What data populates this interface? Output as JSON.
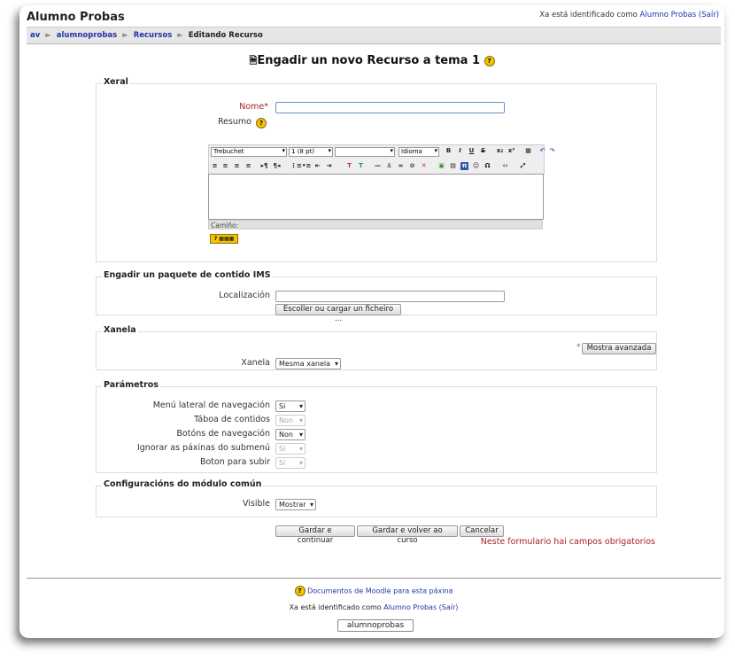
{
  "header": {
    "site_title": "Alumno Probas",
    "login_prefix": "Xa está identificado como ",
    "login_user": "Alumno Probas",
    "login_logout": "(Saír)"
  },
  "breadcrumb": {
    "items": [
      "av",
      "alumnoprobas",
      "Recursos"
    ],
    "current": "Editando Recurso"
  },
  "page": {
    "heading": "Engadir un novo Recurso a tema 1"
  },
  "xeral": {
    "legend": "Xeral",
    "name_label": "Nome",
    "required_mark": "*",
    "summary_label": "Resumo",
    "editor": {
      "font": "Trebuchet",
      "size": "1 (8 pt)",
      "style": "",
      "language": "Idioma",
      "path_label": "Camiño:"
    }
  },
  "ims": {
    "legend": "Engadir un paquete de contido IMS",
    "location_label": "Localización",
    "choose_button": "Escoller ou cargar un ficheiro ..."
  },
  "xanela": {
    "legend": "Xanela",
    "advanced_button": "Mostra avanzada",
    "window_label": "Xanela",
    "window_value": "Mesma xanela"
  },
  "parametros": {
    "legend": "Parámetros",
    "rows": [
      {
        "label": "Menú lateral de navegación",
        "value": "Si",
        "disabled": false
      },
      {
        "label": "Táboa de contidos",
        "value": "Non",
        "disabled": true
      },
      {
        "label": "Botóns de navegación",
        "value": "Non",
        "disabled": false
      },
      {
        "label": "Ignorar as páxinas do submenú",
        "value": "Si",
        "disabled": true
      },
      {
        "label": "Boton para subir",
        "value": "Si",
        "disabled": true
      }
    ]
  },
  "comun": {
    "legend": "Configuracións do módulo común",
    "visible_label": "Visible",
    "visible_value": "Mostrar"
  },
  "actions": {
    "save_continue": "Gardar e continuar",
    "save_return": "Gardar e volver ao curso",
    "cancel": "Cancelar",
    "required_note": "Neste formulario hai campos obrigatorios"
  },
  "footer": {
    "docs_link": "Documentos de Moodle para esta páxina",
    "login_prefix": "Xa está identificado como ",
    "login_user": "Alumno Probas",
    "login_logout": "(Saír)",
    "course_button": "alumnoprobas"
  }
}
